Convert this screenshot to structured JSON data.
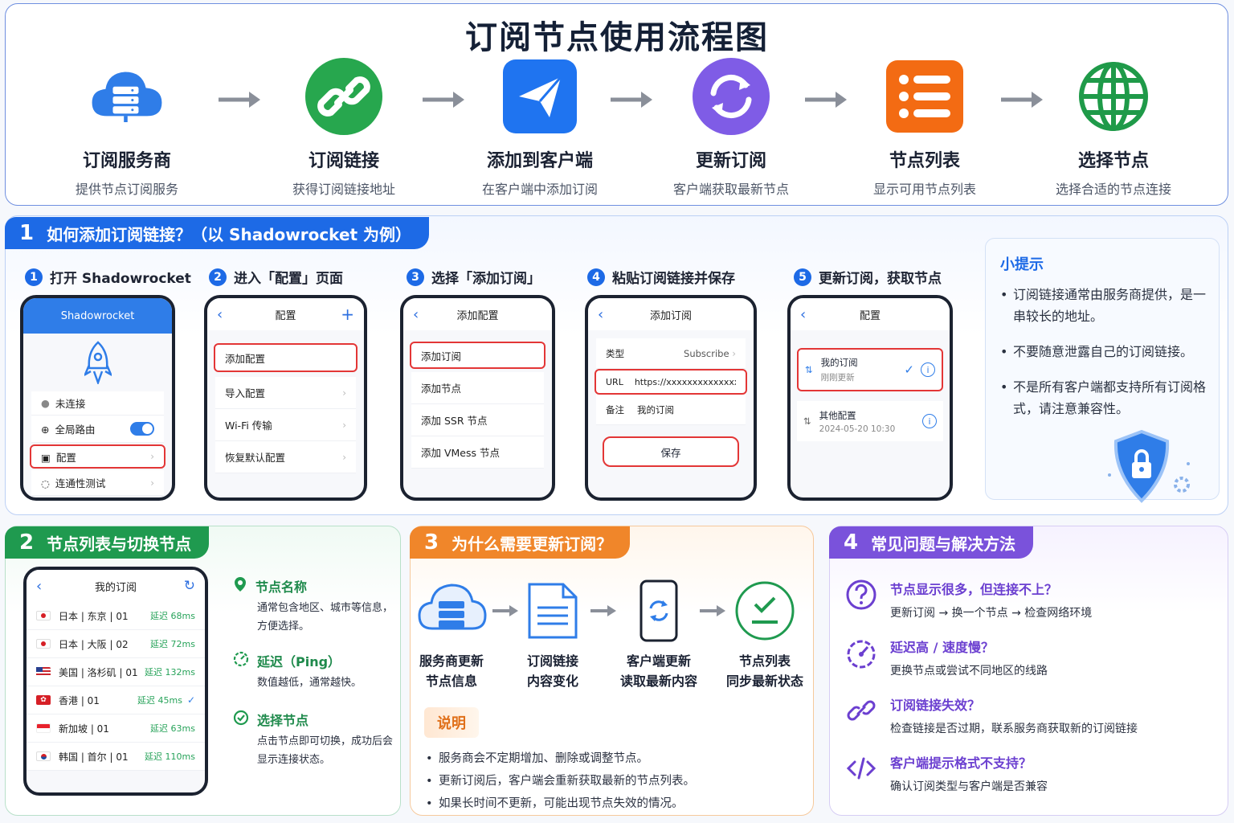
{
  "title": "订阅节点使用流程图",
  "flow": [
    {
      "title": "订阅服务商",
      "desc": "提供节点订阅服务"
    },
    {
      "title": "订阅链接",
      "desc": "获得订阅链接地址"
    },
    {
      "title": "添加到客户端",
      "desc": "在客户端中添加订阅"
    },
    {
      "title": "更新订阅",
      "desc": "客户端获取最新节点"
    },
    {
      "title": "节点列表",
      "desc": "显示可用节点列表"
    },
    {
      "title": "选择节点",
      "desc": "选择合适的节点连接"
    }
  ],
  "section1": {
    "num": "1",
    "title": "如何添加订阅链接？（以 Shadowrocket 为例）",
    "steps": [
      {
        "num": "1",
        "label": "打开 Shadowrocket"
      },
      {
        "num": "2",
        "label": "进入「配置」页面"
      },
      {
        "num": "3",
        "label": "选择「添加订阅」"
      },
      {
        "num": "4",
        "label": "粘贴订阅链接并保存"
      },
      {
        "num": "5",
        "label": "更新订阅，获取节点"
      }
    ],
    "phone1": {
      "app": "Shadowrocket",
      "rows": [
        "未连接",
        "全局路由",
        "配置",
        "连通性测试"
      ]
    },
    "phone2": {
      "title": "配置",
      "rows": [
        "添加配置",
        "导入配置",
        "Wi-Fi 传输",
        "恢复默认配置"
      ]
    },
    "phone3": {
      "title": "添加配置",
      "rows": [
        "添加订阅",
        "添加节点",
        "添加 SSR 节点",
        "添加 VMess 节点"
      ]
    },
    "phone4": {
      "title": "添加订阅",
      "type_label": "类型",
      "type_value": "Subscribe",
      "url_label": "URL",
      "url_value": "https://xxxxxxxxxxxxxx",
      "note_label": "备注",
      "note_value": "我的订阅",
      "save": "保存"
    },
    "phone5": {
      "title": "配置",
      "sub1_name": "我的订阅",
      "sub1_status": "刚刚更新",
      "sub2_name": "其他配置",
      "sub2_time": "2024-05-20 10:30"
    },
    "tips": {
      "title": "小提示",
      "items": [
        "订阅链接通常由服务商提供，是一串较长的地址。",
        "不要随意泄露自己的订阅链接。",
        "不是所有客户端都支持所有订阅格式，请注意兼容性。"
      ]
    }
  },
  "section2": {
    "num": "2",
    "title": "节点列表与切换节点",
    "phone": {
      "title": "我的订阅",
      "nodes": [
        {
          "name": "日本 | 东京 | 01",
          "latency": "延迟 68ms"
        },
        {
          "name": "日本 | 大阪 | 02",
          "latency": "延迟 72ms"
        },
        {
          "name": "美国 | 洛杉矶 | 01",
          "latency": "延迟 132ms"
        },
        {
          "name": "香港 | 01",
          "latency": "延迟 45ms"
        },
        {
          "name": "新加坡 | 01",
          "latency": "延迟 63ms"
        },
        {
          "name": "韩国 | 首尔 | 01",
          "latency": "延迟 110ms"
        }
      ]
    },
    "info": [
      {
        "title": "节点名称",
        "desc": "通常包含地区、城市等信息，方便选择。"
      },
      {
        "title": "延迟（Ping）",
        "desc": "数值越低，通常越快。"
      },
      {
        "title": "选择节点",
        "desc": "点击节点即可切换，成功后会显示连接状态。"
      }
    ]
  },
  "section3": {
    "num": "3",
    "title": "为什么需要更新订阅？",
    "flow": [
      {
        "line1": "服务商更新",
        "line2": "节点信息"
      },
      {
        "line1": "订阅链接",
        "line2": "内容变化"
      },
      {
        "line1": "客户端更新",
        "line2": "读取最新内容"
      },
      {
        "line1": "节点列表",
        "line2": "同步最新状态"
      }
    ],
    "note_title": "说明",
    "notes": [
      "服务商会不定期增加、删除或调整节点。",
      "更新订阅后，客户端会重新获取最新的节点列表。",
      "如果长时间不更新，可能出现节点失效的情况。"
    ]
  },
  "section4": {
    "num": "4",
    "title": "常见问题与解决方法",
    "faqs": [
      {
        "q": "节点显示很多，但连接不上？",
        "a": "更新订阅 → 换一个节点 → 检查网络环境"
      },
      {
        "q": "延迟高 / 速度慢？",
        "a": "更换节点或尝试不同地区的线路"
      },
      {
        "q": "订阅链接失效？",
        "a": "检查链接是否过期，联系服务商获取新的订阅链接"
      },
      {
        "q": "客户端提示格式不支持？",
        "a": "确认订阅类型与客户端是否兼容"
      }
    ]
  }
}
